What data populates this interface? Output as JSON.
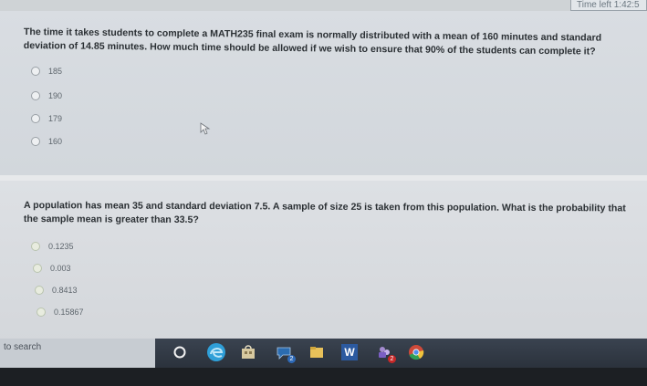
{
  "timer": {
    "text": "Time left 1:42:5"
  },
  "question1": {
    "text": "The time it takes students to complete a MATH235 final exam is normally distributed with a mean of 160 minutes and standard deviation of 14.85 minutes. How much time should be allowed if we wish to ensure that 90% of the students can complete it?",
    "options": [
      "185",
      "190",
      "179",
      "160"
    ]
  },
  "question2": {
    "text": "A population has mean 35 and standard deviation 7.5. A sample of size 25 is taken from this population. What is the probability that the sample mean is greater than 33.5?",
    "options": [
      "0.1235",
      "0.003",
      "0.8413",
      "0.15867"
    ]
  },
  "taskbar": {
    "search_text": "to search",
    "badge_1": "2",
    "badge_2": "2",
    "word_label": "W"
  },
  "icons": {
    "cortana": "cortana-icon",
    "edge": "edge-icon",
    "store": "store-icon",
    "chat": "chat-icon",
    "files": "file-explorer-icon",
    "word": "word-icon",
    "teams": "teams-icon",
    "chrome": "chrome-icon"
  }
}
